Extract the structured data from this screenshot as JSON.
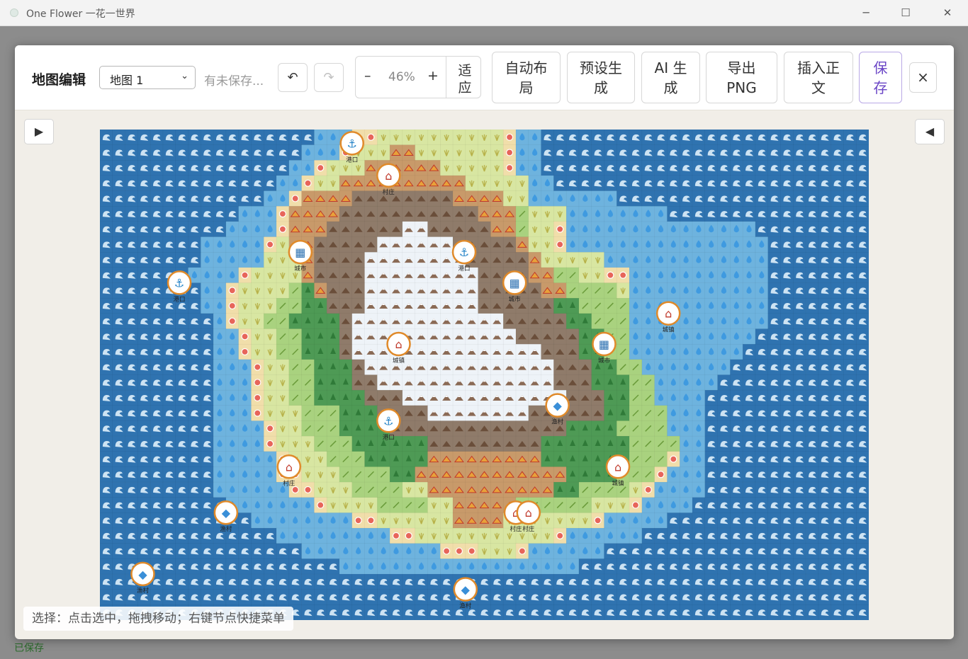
{
  "window": {
    "title": "One Flower 一花一世界"
  },
  "background": {
    "status": "已保存"
  },
  "editor": {
    "title": "地图编辑",
    "map_select": "地图 1",
    "unsaved": "有未保存...",
    "undo": "↶",
    "redo": "↷",
    "zoom_out": "–",
    "zoom_level": "46%",
    "zoom_in": "+",
    "fit_l1": "适",
    "fit_l2": "应",
    "auto_layout_l1": "自动布",
    "auto_layout_l2": "局",
    "preset_l1": "预设生",
    "preset_l2": "成",
    "ai_l1": "AI 生",
    "ai_l2": "成",
    "export_l1": "导出",
    "export_l2": "PNG",
    "insert_l1": "插入正",
    "insert_l2": "文",
    "save_l1": "保",
    "save_l2": "存",
    "close": "×",
    "hint": "选择：点击选中，拖拽移动；右键节点快捷菜单",
    "colors": {
      "accent": "#6a45c6"
    }
  },
  "map": {
    "terrain": [
      "DDDDDDDDDDDDDDDDDSSSBBYYYYYYYYYYBSSDDDDDDDDDDDDDDDDDDDDDDDDDD",
      "DDDDDDDDDDDDDDDDSSSBYYYHHYYYYYYYBSSDDDDDDDDDDDDDDDDDDDDDDDDDD",
      "DDDDDDDDDDDDDDDSSBYYYHHHHHHYYYYYBSSDDDDDDDDDDDDDDDDDDDDDDDDDD",
      "DDDDDDDDDDDDDDSSBYYHHHHHHHHHHYYYYYSSDDDDDDDDDDDDDDDDDDDDDDDDD",
      "DDDDDDDDDDDDDSSBHHHHMMMMMMMMHHHHYYSSSSSSSDDDDDDDDDDDDDDDDDDDD",
      "DDDDDDDDDDDSSSBHHHHMMMMMMMMMMMHHHGYYYSSSSSSSSDDDDDDDDDDDDDDDD",
      "DDDDDDDDDDSSSSBHHHMMMMMMNNMMMMMHHGYYBSSSSSSSSSSSSSSSDDDDDDDDD",
      "DDDDDDDDSSSSSBYHHMMMMMNNNNNNMMMMMHYYBSSSSSSSSSSSSSSSSDDDDDDDD",
      "DDDDDDDDSSSSSYYYHMMMMNNNNNNNNMMMMMHYYYYYSSSSSSSSSSSSSDDDDDDDD",
      "DDDDDDDSSSSBYYYYHMMMMNNNNNNNNNMMMMHHGGYYBBSSSSSSSSSSSDDDDDDDD",
      "DDDDDDDDSSBYYYYGFHMMMNNNNNNNNNMMMMMHHGGGGYSSSSSSSSSSSDDDDDDDD",
      "DDDDDDDDSSBYYYGGFFMMMNNNNNNNNNMMMMMMFFGGGGSSSSSSSSSSSDDDDDDDD",
      "DDDDDDDDDSBYYGGFFFFMNNNNNNNNNNNNMMMMMFFGGGSSSSSSSSSSSDDDDDDDD",
      "DDDDDDDDDSSBYYGGFFFMNNNNNNNNNNNNNMMMMMFFGGSSSSSSSSSSDDDDDDDDD",
      "DDDDDDDDDSSBYYGGFFFMNNNNNNNNNNNNNNNMMMFFGGSSSSSSSSSDDDDDDDDDD",
      "DDDDDDDDDSSSBYYGGFFFMNNNNNNNNNNNNNNNMMMFFGGSSSSSSSDDDDDDDDDDD",
      "DDDDDDDDDSSSBYYGGFFFMMNNNNNNNNNNNNNNMMMFFFGGSSSSSDDDDDDDDDDDD",
      "DDDDDDDDDSSSBYYGGFFFFMMMNNNNNNNNNNNNNMMMFFGGSSSSDDDDDDDDDDDDD",
      "DDDDDDDDDSSSBYYYGGGFFFMMMMNNNNNNNNMMMMMMFFGGGSSSDDDDDDDDDDDDD",
      "DDDDDDDDDSSSSBYYGGGFFFFMMMMMMMMMMMMMMFFFFGGGGSSSDDDDDDDDDDDDD",
      "DDDDDDDDDSSSSBYYYGGGFFFFFFMMMMMMMMMFFFFFFFGGGGSSDDDDDDDDDDDDD",
      "DDDDDDDDDSSSSSBYYYGGGFFFFFHHHHHHHHHFFFFFFFGGGBSSDDDDDDDDDDDDD",
      "DDDDDDDDDSSSSSBBYYYGGGGFFHHHHHHHHHHHHFFFFGGGBSSSDDDDDDDDDDDDD",
      "DDDDDDDDDSSSSSSBBYYYGGGGYYHHHHHHHHHHFFGGGGYBSSSSDDDDDDDDDDDDD",
      "DDDDDDDDDDSSSSSSSBYYYYGGGGYYHHHHHGGGGGGYYYBSSSSDDDDDDDDDDDDDD",
      "DDDDDDDDDDDDSSSSSSSSBBYYYYYYHHHHYYYYYYYBSSSSSDDDDDDDDDDDDDDDD",
      "DDDDDDDDDDDDDDSSSSSSSSSBBYYYYYYYYYYYBSSSSSSDDDDDDDDDDDDDDDDDD",
      "DDDDDDDDDDDDDDDDSSSSSSSSSSSBBBYYYBSSSSSSDDDDDDDDDDDDDDDDDDDDD",
      "DDDDDDDDDDDDDDDDDDDSSSSSSSSSSSSSSSSSSSDDDDDDDDDDDDDDDDDDDDDDD",
      "DDDDDDDDDDDDDDDDDDDDDDDDDDDDDDDDDDDDDDDDDDDDDDDDDDDDDDDDDDDDD",
      "DDDDDDDDDDDDDDDDDDDDDDDDDDDDDDDDDDDDDDDDDDDDDDDDDDDDDDDDDDDDD",
      "DDDDDDDDDDDDDDDDDDDDDDDDDDDDDDDDDDDDDDDDDDDDDDDDDDDDDDDDDDDDD"
    ],
    "terrain_legend": {
      "D": {
        "color": "#2f73b0",
        "glyph": "wave-icon"
      },
      "S": {
        "color": "#6eb3de",
        "glyph": "droplet-icon"
      },
      "B": {
        "color": "#f1deaa",
        "glyph": "beach-icon"
      },
      "Y": {
        "color": "#d8e6a2",
        "glyph": "grass-icon"
      },
      "G": {
        "color": "#a9d27f",
        "glyph": "plain-icon"
      },
      "F": {
        "color": "#4e9a55",
        "glyph": "tree-icon"
      },
      "H": {
        "color": "#c89a6a",
        "glyph": "hill-icon"
      },
      "M": {
        "color": "#8f7b6a",
        "glyph": "mountain-icon"
      },
      "N": {
        "color": "#eef3f8",
        "glyph": "snow-mountain-icon"
      }
    },
    "nodes": [
      {
        "type": "port",
        "label": "港口",
        "c": 19.5,
        "r": 0.3
      },
      {
        "type": "village",
        "label": "村庄",
        "c": 22.4,
        "r": 2.4
      },
      {
        "type": "city",
        "label": "城市",
        "c": 15.4,
        "r": 7.4
      },
      {
        "type": "port",
        "label": "港口",
        "c": 28.4,
        "r": 7.4
      },
      {
        "type": "port",
        "label": "港口",
        "c": 5.8,
        "r": 9.4
      },
      {
        "type": "city",
        "label": "城市",
        "c": 32.4,
        "r": 9.4
      },
      {
        "type": "town",
        "label": "城镇",
        "c": 44.6,
        "r": 11.4
      },
      {
        "type": "town",
        "label": "城镇",
        "c": 23.2,
        "r": 13.4
      },
      {
        "type": "city",
        "label": "城市",
        "c": 39.5,
        "r": 13.4
      },
      {
        "type": "fishing",
        "label": "渔村",
        "c": 35.8,
        "r": 17.4
      },
      {
        "type": "port",
        "label": "港口",
        "c": 22.4,
        "r": 18.4
      },
      {
        "type": "village",
        "label": "村庄",
        "c": 14.5,
        "r": 21.4
      },
      {
        "type": "town",
        "label": "城镇",
        "c": 40.6,
        "r": 21.4
      },
      {
        "type": "fishing",
        "label": "渔村",
        "c": 9.5,
        "r": 24.4
      },
      {
        "type": "village",
        "label": "村庄",
        "c": 32.5,
        "r": 24.4
      },
      {
        "type": "village",
        "label": "村庄",
        "c": 33.5,
        "r": 24.4
      },
      {
        "type": "fishing",
        "label": "渔村",
        "c": 2.9,
        "r": 28.4
      },
      {
        "type": "fishing",
        "label": "渔村",
        "c": 28.5,
        "r": 29.4
      }
    ]
  }
}
